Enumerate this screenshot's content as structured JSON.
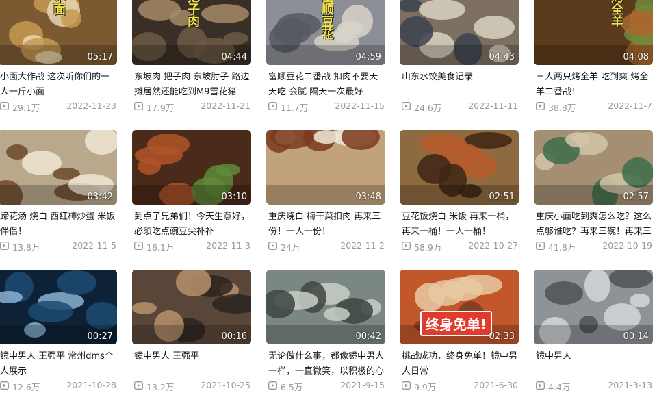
{
  "videos": [
    {
      "duration": "05:17",
      "title": "小面大作战 这次听你们的一人一斤小面",
      "views": "29.1万",
      "date": "2022-11-23",
      "caption": "小面",
      "theme": "noodles"
    },
    {
      "duration": "04:44",
      "title": "东坡肉 把子肉 东坡肘子 路边摊居然还能吃到M9雪花猪",
      "views": "17.9万",
      "date": "2022-11-21",
      "caption": "把子肉",
      "theme": "pots"
    },
    {
      "duration": "04:59",
      "title": "富顺豆花二番战 扣肉不要天天吃 会腻 隔天一次最好",
      "views": "11.7万",
      "date": "2022-11-15",
      "caption": "富顺豆花",
      "theme": "tofu"
    },
    {
      "duration": "04:43",
      "title": "山东水饺美食记录",
      "views": "24.6万",
      "date": "2022-11-11",
      "caption": "",
      "theme": "dumplings"
    },
    {
      "duration": "04:08",
      "title": "三人两只烤全羊 吃到爽 烤全羊二番战！",
      "views": "38.8万",
      "date": "2022-11-7",
      "caption": "烤全羊",
      "theme": "lamb"
    },
    {
      "duration": "03:42",
      "title": "蹄花汤 烧白 西红柿炒蛋 米饭伴侣！",
      "views": "13.8万",
      "date": "2022-11-5",
      "caption": "",
      "theme": "bowls"
    },
    {
      "duration": "03:10",
      "title": "到点了兄弟们！今天生意好，必须吃点豌豆尖补补",
      "views": "16.1万",
      "date": "2022-11-3",
      "caption": "",
      "theme": "bbq"
    },
    {
      "duration": "03:48",
      "title": "重庆烧白 梅干菜扣肉 再来三份！一人一份！",
      "views": "24万",
      "date": "2022-11-2",
      "caption": "",
      "theme": "plates"
    },
    {
      "duration": "02:51",
      "title": "豆花饭烧白 米饭 再来一桶，再来一桶！一人一桶！",
      "views": "58.9万",
      "date": "2022-10-27",
      "caption": "",
      "theme": "feast"
    },
    {
      "duration": "02:57",
      "title": "重庆小面吃到爽怎么吃？这么点够谁吃？再来三碗！再来三",
      "views": "41.8万",
      "date": "2022-10-19",
      "caption": "",
      "theme": "shop"
    },
    {
      "duration": "00:27",
      "title": "镜中男人 王强平 常州dms个人展示",
      "views": "12.6万",
      "date": "2021-10-28",
      "caption": "",
      "theme": "stage"
    },
    {
      "duration": "00:16",
      "title": "镜中男人 王强平",
      "views": "13.2万",
      "date": "2021-10-25",
      "caption": "",
      "theme": "backstage"
    },
    {
      "duration": "00:42",
      "title": "无论做什么事，都像镜中男人一样，一直微笑，以积极的心",
      "views": "6.5万",
      "date": "2021-9-15",
      "caption": "",
      "theme": "gym"
    },
    {
      "duration": "02:33",
      "title": "挑战成功，终身免单！镜中男人日常",
      "views": "9.9万",
      "date": "2021-6-30",
      "caption": "终身免单!",
      "theme": "shopfront"
    },
    {
      "duration": "00:14",
      "title": "镜中男人",
      "views": "4.4万",
      "date": "2021-3-13",
      "caption": "",
      "theme": "fitness"
    }
  ]
}
